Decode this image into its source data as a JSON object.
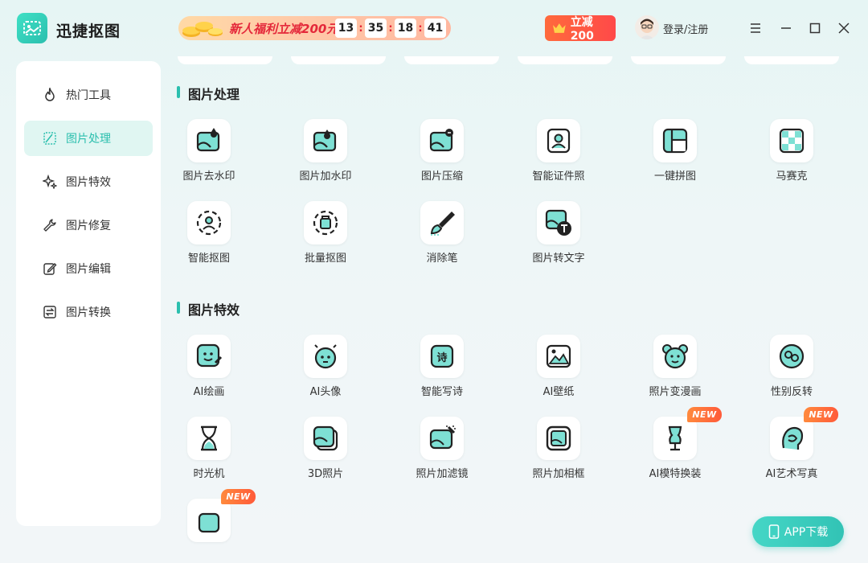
{
  "app": {
    "title": "迅捷抠图"
  },
  "promo": {
    "text": "新人福利立减200元",
    "countdown": [
      "13",
      "35",
      "18",
      "41"
    ]
  },
  "header": {
    "discount_label": "立减200",
    "login_label": "登录/注册"
  },
  "sidebar": {
    "items": [
      {
        "label": "热门工具",
        "icon": "flame-icon"
      },
      {
        "label": "图片处理",
        "icon": "image-process-icon",
        "active": true
      },
      {
        "label": "图片特效",
        "icon": "sparkle-icon"
      },
      {
        "label": "图片修复",
        "icon": "wrench-icon"
      },
      {
        "label": "图片编辑",
        "icon": "edit-icon"
      },
      {
        "label": "图片转换",
        "icon": "convert-icon"
      }
    ]
  },
  "sections": [
    {
      "title": "图片处理",
      "tools": [
        {
          "label": "图片去水印",
          "icon": "remove-watermark-icon"
        },
        {
          "label": "图片加水印",
          "icon": "add-watermark-icon"
        },
        {
          "label": "图片压缩",
          "icon": "compress-icon"
        },
        {
          "label": "智能证件照",
          "icon": "id-photo-icon"
        },
        {
          "label": "一键拼图",
          "icon": "collage-icon"
        },
        {
          "label": "马赛克",
          "icon": "mosaic-icon"
        },
        {
          "label": "智能抠图",
          "icon": "smart-cutout-icon"
        },
        {
          "label": "批量抠图",
          "icon": "batch-cutout-icon"
        },
        {
          "label": "消除笔",
          "icon": "eraser-brush-icon"
        },
        {
          "label": "图片转文字",
          "icon": "image-to-text-icon"
        }
      ]
    },
    {
      "title": "图片特效",
      "tools": [
        {
          "label": "AI绘画",
          "icon": "ai-drawing-icon"
        },
        {
          "label": "AI头像",
          "icon": "ai-avatar-icon"
        },
        {
          "label": "智能写诗",
          "icon": "poem-icon"
        },
        {
          "label": "AI壁纸",
          "icon": "wallpaper-icon"
        },
        {
          "label": "照片变漫画",
          "icon": "cartoon-icon"
        },
        {
          "label": "性别反转",
          "icon": "gender-swap-icon"
        },
        {
          "label": "时光机",
          "icon": "hourglass-icon"
        },
        {
          "label": "3D照片",
          "icon": "3d-photo-icon"
        },
        {
          "label": "照片加滤镜",
          "icon": "filter-icon"
        },
        {
          "label": "照片加相框",
          "icon": "frame-icon"
        },
        {
          "label": "AI模特换装",
          "icon": "mannequin-icon",
          "badge": "NEW"
        },
        {
          "label": "AI艺术写真",
          "icon": "art-portrait-icon",
          "badge": "NEW"
        },
        {
          "label": "",
          "icon": "partial-tool-icon",
          "badge": "NEW"
        }
      ]
    }
  ],
  "app_download": {
    "label": "APP下载"
  },
  "colors": {
    "accent": "#2bbfae",
    "promo_red": "#e4283a",
    "badge_orange": "#ff6a3c"
  }
}
